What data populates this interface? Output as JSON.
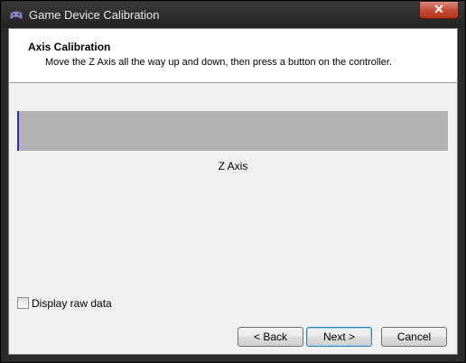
{
  "window": {
    "title": "Game Device Calibration",
    "close_glyph": "✕"
  },
  "header": {
    "title": "Axis Calibration",
    "description": "Move the Z Axis all the way up and down, then press a button on the controller."
  },
  "axis": {
    "label": "Z Axis",
    "value_fraction": 0.0,
    "bar_color": "#b2b2b2",
    "marker_color": "#2a2ad0"
  },
  "options": {
    "display_raw_data_label": "Display raw data",
    "display_raw_data_checked": false
  },
  "buttons": {
    "back": "< Back",
    "next": "Next >",
    "cancel": "Cancel"
  },
  "icons": {
    "title": "game-controller-icon",
    "close": "close-icon"
  }
}
